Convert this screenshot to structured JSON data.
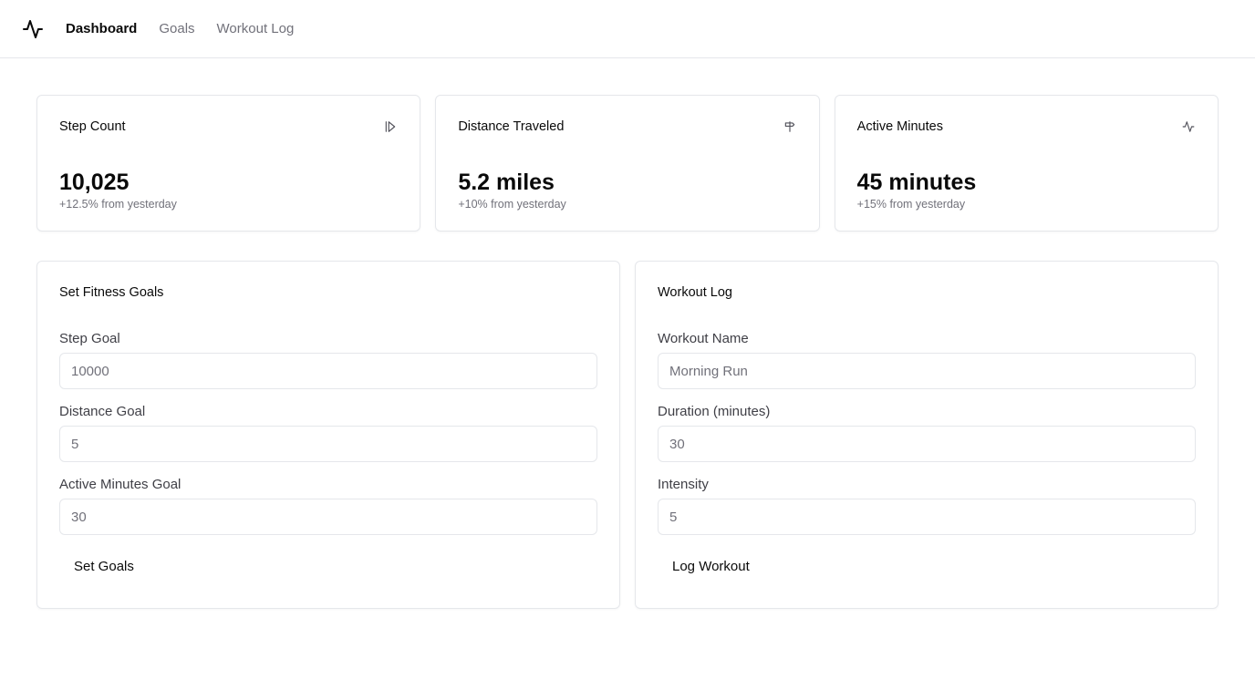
{
  "nav": {
    "logo_icon": "activity-icon",
    "links": [
      "Dashboard",
      "Goals",
      "Workout Log"
    ]
  },
  "stats": [
    {
      "title": "Step Count",
      "value": "10,025",
      "delta": "+12.5% from yesterday",
      "icon": "footprints-icon"
    },
    {
      "title": "Distance Traveled",
      "value": "5.2 miles",
      "delta": "+10% from yesterday",
      "icon": "signpost-icon"
    },
    {
      "title": "Active Minutes",
      "value": "45 minutes",
      "delta": "+15% from yesterday",
      "icon": "activity-icon"
    }
  ],
  "goals": {
    "title": "Set Fitness Goals",
    "step_label": "Step Goal",
    "step_placeholder": "10000",
    "distance_label": "Distance Goal",
    "distance_placeholder": "5",
    "active_label": "Active Minutes Goal",
    "active_placeholder": "30",
    "button": "Set Goals"
  },
  "workout": {
    "title": "Workout Log",
    "name_label": "Workout Name",
    "name_placeholder": "Morning Run",
    "duration_label": "Duration (minutes)",
    "duration_placeholder": "30",
    "intensity_label": "Intensity",
    "intensity_placeholder": "5",
    "button": "Log Workout"
  },
  "colors": {
    "text": "#0a0a0a",
    "muted": "#71717a",
    "border": "#e5e7eb"
  }
}
